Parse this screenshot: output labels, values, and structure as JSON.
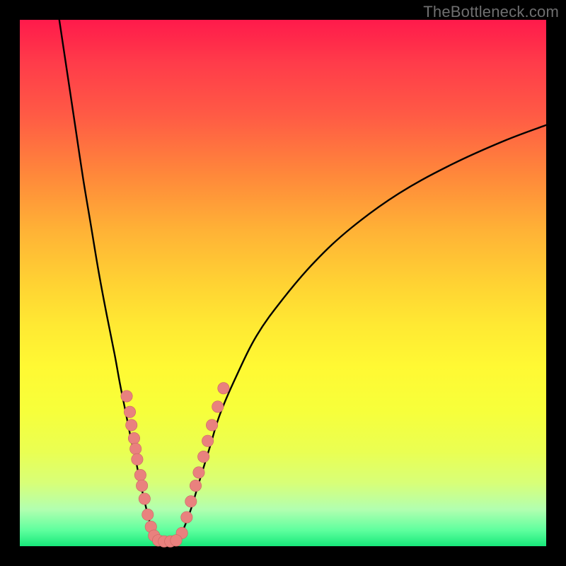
{
  "watermark": "TheBottleneck.com",
  "colors": {
    "frame": "#000000",
    "curve": "#000000",
    "dot_fill": "#e9817e",
    "dot_stroke": "#c86762"
  },
  "chart_data": {
    "type": "line",
    "title": "",
    "xlabel": "",
    "ylabel": "",
    "xlim": [
      0,
      100
    ],
    "ylim": [
      0,
      100
    ],
    "series": [
      {
        "name": "left-branch",
        "x": [
          7.5,
          9,
          10.5,
          12,
          13.5,
          15,
          16.5,
          18,
          19,
          20,
          21,
          22,
          22.8,
          23.6,
          24.3,
          25,
          25.6,
          26
        ],
        "y": [
          100,
          90,
          80,
          70,
          61,
          52,
          44,
          36.5,
          31,
          26,
          21,
          16.5,
          12.5,
          9,
          6,
          3.5,
          1.8,
          0.9
        ]
      },
      {
        "name": "right-branch",
        "x": [
          30,
          31,
          32.5,
          34,
          36,
          38,
          41,
          45,
          50,
          56,
          63,
          72,
          82,
          92,
          100
        ],
        "y": [
          0.9,
          3,
          7,
          12,
          18.5,
          25,
          32,
          40,
          47,
          54,
          60.5,
          67,
          72.5,
          77,
          80
        ]
      },
      {
        "name": "floor",
        "x": [
          26,
          27,
          28,
          29,
          30
        ],
        "y": [
          0.9,
          0.7,
          0.7,
          0.7,
          0.9
        ]
      }
    ],
    "dots_left": [
      {
        "x": 20.3,
        "y": 28.5
      },
      {
        "x": 20.9,
        "y": 25.5
      },
      {
        "x": 21.2,
        "y": 23.0
      },
      {
        "x": 21.7,
        "y": 20.5
      },
      {
        "x": 22.0,
        "y": 18.5
      },
      {
        "x": 22.3,
        "y": 16.5
      },
      {
        "x": 22.9,
        "y": 13.5
      },
      {
        "x": 23.2,
        "y": 11.5
      },
      {
        "x": 23.7,
        "y": 9.0
      },
      {
        "x": 24.3,
        "y": 6.0
      },
      {
        "x": 24.9,
        "y": 3.7
      },
      {
        "x": 25.5,
        "y": 2.0
      }
    ],
    "dots_right": [
      {
        "x": 30.8,
        "y": 2.5
      },
      {
        "x": 31.7,
        "y": 5.5
      },
      {
        "x": 32.5,
        "y": 8.5
      },
      {
        "x": 33.4,
        "y": 11.5
      },
      {
        "x": 34.0,
        "y": 14.0
      },
      {
        "x": 34.9,
        "y": 17.0
      },
      {
        "x": 35.7,
        "y": 20.0
      },
      {
        "x": 36.5,
        "y": 23.0
      },
      {
        "x": 37.6,
        "y": 26.5
      },
      {
        "x": 38.7,
        "y": 30.0
      }
    ],
    "dots_floor": [
      {
        "x": 26.3,
        "y": 1.1
      },
      {
        "x": 27.4,
        "y": 0.9
      },
      {
        "x": 28.6,
        "y": 0.9
      },
      {
        "x": 29.7,
        "y": 1.1
      }
    ]
  }
}
